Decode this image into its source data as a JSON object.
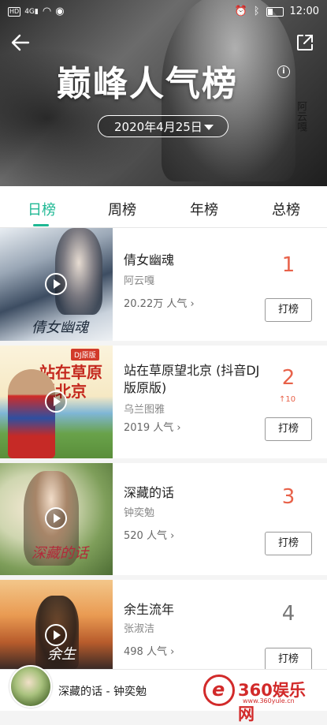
{
  "status_bar": {
    "network": "HD",
    "signal_label": "4G",
    "time": "12:00"
  },
  "header": {
    "title": "巅峰人气榜",
    "date": "2020年4月25日",
    "seal_text": "阿云嘎"
  },
  "tabs": [
    {
      "label": "日榜",
      "active": true
    },
    {
      "label": "周榜",
      "active": false
    },
    {
      "label": "年榜",
      "active": false
    },
    {
      "label": "总榜",
      "active": false
    }
  ],
  "songs": [
    {
      "title": "倩女幽魂",
      "artist": "阿云嘎",
      "popularity": "20.22万 人气",
      "rank": "1",
      "rank_change": "",
      "vote": "打榜",
      "cover_text": "倩女幽魂"
    },
    {
      "title": "站在草原望北京 (抖音DJ版原版)",
      "artist": "乌兰图雅",
      "popularity": "2019 人气",
      "rank": "2",
      "rank_change": "10",
      "vote": "打榜",
      "cover_text": "站在草原望北京",
      "cover_badge": "DJ原版"
    },
    {
      "title": "深藏的话",
      "artist": "钟奕勉",
      "popularity": "520 人气",
      "rank": "3",
      "rank_change": "",
      "vote": "打榜",
      "cover_text": "深藏的话"
    },
    {
      "title": "余生流年",
      "artist": "张淑洁",
      "popularity": "498 人气",
      "rank": "4",
      "rank_change": "",
      "vote": "打榜",
      "cover_text": "余生"
    }
  ],
  "player": {
    "now_playing": "深藏的话 - 钟奕勉"
  },
  "watermark": {
    "brand": "360娱乐网",
    "url": "www.360yule.cn"
  },
  "colors": {
    "accent": "#1fb894",
    "rank_top": "#e8624a",
    "rank_other": "#777777"
  }
}
